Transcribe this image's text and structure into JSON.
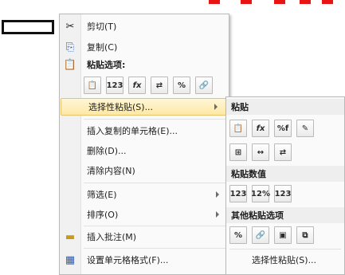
{
  "menu": {
    "items": [
      {
        "label": "剪切(T)",
        "icon": "scissors-icon"
      },
      {
        "label": "复制(C)",
        "icon": "copy-icon"
      },
      {
        "label": "粘贴选项:",
        "icon": "paste-icon"
      },
      {
        "label": "选择性粘贴(S)...",
        "icon": ""
      },
      {
        "label": "插入复制的单元格(E)...",
        "icon": ""
      },
      {
        "label": "删除(D)...",
        "icon": ""
      },
      {
        "label": "清除内容(N)",
        "icon": ""
      },
      {
        "label": "筛选(E)",
        "icon": ""
      },
      {
        "label": "排序(O)",
        "icon": ""
      },
      {
        "label": "插入批注(M)",
        "icon": "insert-comment-icon"
      },
      {
        "label": "设置单元格格式(F)...",
        "icon": "format-cells-icon"
      }
    ],
    "paste_buttons": [
      "paste",
      "123",
      "fx",
      "transpose",
      "%",
      "link"
    ]
  },
  "submenu": {
    "section_paste": "粘贴",
    "section_values": "粘贴数值",
    "section_other": "其他粘贴选项",
    "paste_buttons": [
      "paste",
      "fx",
      "%fx",
      "keep-width"
    ],
    "paste_buttons_2": [
      "no-borders",
      "col-width",
      "transpose"
    ],
    "value_buttons": [
      "123",
      "123%",
      "123-formats"
    ],
    "other_buttons": [
      "%",
      "link",
      "picture",
      "linked-picture"
    ],
    "special_label": "选择性粘贴(S)..."
  },
  "colors": {
    "highlight": "#fde9a4",
    "accent_red": "#e81313"
  }
}
